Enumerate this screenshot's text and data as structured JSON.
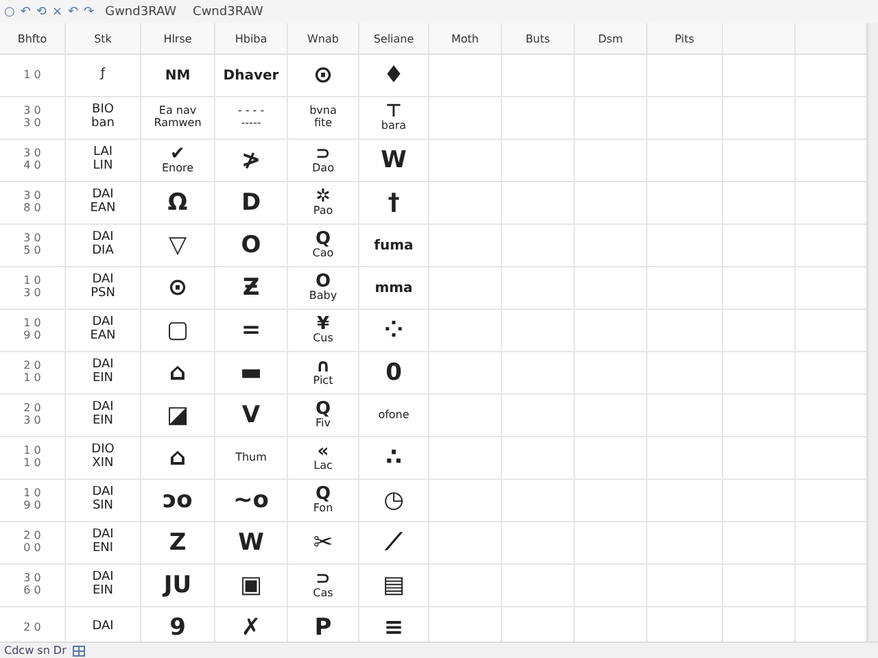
{
  "toolbar": {
    "icons": [
      "○",
      "↶",
      "⟲",
      "×",
      "↶",
      "↷"
    ],
    "tabs": [
      "Gwnd3RAW",
      "Cwnd3RAW"
    ]
  },
  "table": {
    "columns": [
      "Bhfto",
      "Stk",
      "Hlrse",
      "Hbiba",
      "Wnab",
      "Seliane",
      "Moth",
      "Buts",
      "Dsm",
      "Pits",
      "",
      ""
    ],
    "rows": [
      {
        "cells": [
          {
            "kind": "num",
            "lines": [
              "1 0"
            ]
          },
          {
            "kind": "code",
            "lines": [
              "ƒ"
            ]
          },
          {
            "kind": "word",
            "text": "NM"
          },
          {
            "kind": "word",
            "text": "Dhaver"
          },
          {
            "kind": "symbol",
            "text": "⊙"
          },
          {
            "kind": "symbol",
            "text": "♦"
          }
        ]
      },
      {
        "cells": [
          {
            "kind": "num",
            "lines": [
              "3 0",
              "3 0"
            ]
          },
          {
            "kind": "code",
            "lines": [
              "BIO",
              "ban"
            ]
          },
          {
            "kind": "note",
            "lines": [
              "Ea nav",
              "Ramwen"
            ]
          },
          {
            "kind": "note",
            "lines": [
              "- - - -",
              "-----"
            ]
          },
          {
            "kind": "note",
            "lines": [
              "bvna",
              "fite"
            ]
          },
          {
            "kind": "symbol",
            "text": "⊤",
            "caption": "bara"
          }
        ]
      },
      {
        "cells": [
          {
            "kind": "num",
            "lines": [
              "3 0",
              "4 0"
            ]
          },
          {
            "kind": "code",
            "lines": [
              "LAI",
              "LIN"
            ]
          },
          {
            "kind": "symbol",
            "text": "✔",
            "caption": "Enore"
          },
          {
            "kind": "symbol",
            "text": "≯"
          },
          {
            "kind": "symbol",
            "text": "⊃",
            "caption": "Dao"
          },
          {
            "kind": "symbol",
            "text": "W"
          }
        ]
      },
      {
        "cells": [
          {
            "kind": "num",
            "lines": [
              "3 0",
              "8 0"
            ]
          },
          {
            "kind": "code",
            "lines": [
              "DAI",
              "EAN"
            ]
          },
          {
            "kind": "symbol",
            "text": "Ω"
          },
          {
            "kind": "symbol",
            "text": "D"
          },
          {
            "kind": "symbol",
            "text": "✲",
            "caption": "Pao"
          },
          {
            "kind": "symbol",
            "text": "†"
          }
        ]
      },
      {
        "cells": [
          {
            "kind": "num",
            "lines": [
              "3 0",
              "5 0"
            ]
          },
          {
            "kind": "code",
            "lines": [
              "DAI",
              "DIA"
            ]
          },
          {
            "kind": "symbol",
            "text": "▽"
          },
          {
            "kind": "symbol",
            "text": "O"
          },
          {
            "kind": "symbol",
            "text": "Q",
            "caption": "Cao"
          },
          {
            "kind": "word",
            "text": "fuma"
          }
        ]
      },
      {
        "cells": [
          {
            "kind": "num",
            "lines": [
              "1 0",
              "3 0"
            ]
          },
          {
            "kind": "code",
            "lines": [
              "DAI",
              "PSN"
            ]
          },
          {
            "kind": "symbol",
            "text": "⊙"
          },
          {
            "kind": "symbol",
            "text": "Ƶ"
          },
          {
            "kind": "symbol",
            "text": "O",
            "caption": "Baby"
          },
          {
            "kind": "word",
            "text": "mma"
          }
        ]
      },
      {
        "cells": [
          {
            "kind": "num",
            "lines": [
              "1 0",
              "9 0"
            ]
          },
          {
            "kind": "code",
            "lines": [
              "DAI",
              "EAN"
            ]
          },
          {
            "kind": "symbol",
            "text": "▢"
          },
          {
            "kind": "symbol",
            "text": "="
          },
          {
            "kind": "symbol",
            "text": "¥",
            "caption": "Cus"
          },
          {
            "kind": "symbol",
            "text": "⁘"
          }
        ]
      },
      {
        "cells": [
          {
            "kind": "num",
            "lines": [
              "2 0",
              "1 0"
            ]
          },
          {
            "kind": "code",
            "lines": [
              "DAI",
              "EIN"
            ]
          },
          {
            "kind": "symbol",
            "text": "⌂"
          },
          {
            "kind": "symbol",
            "text": "▬"
          },
          {
            "kind": "symbol",
            "text": "∩",
            "caption": "Pict"
          },
          {
            "kind": "symbol",
            "text": "0"
          }
        ]
      },
      {
        "cells": [
          {
            "kind": "num",
            "lines": [
              "2 0",
              "3 0"
            ]
          },
          {
            "kind": "code",
            "lines": [
              "DAI",
              "EIN"
            ]
          },
          {
            "kind": "symbol",
            "text": "◪"
          },
          {
            "kind": "symbol",
            "text": "V"
          },
          {
            "kind": "symbol",
            "text": "Q",
            "caption": "Fiv"
          },
          {
            "kind": "note",
            "lines": [
              "ofone"
            ]
          }
        ]
      },
      {
        "cells": [
          {
            "kind": "num",
            "lines": [
              "1 0",
              "1 0"
            ]
          },
          {
            "kind": "code",
            "lines": [
              "DIO",
              "XIN"
            ]
          },
          {
            "kind": "symbol",
            "text": "⌂"
          },
          {
            "kind": "note",
            "lines": [
              "Thum"
            ]
          },
          {
            "kind": "symbol",
            "text": "«",
            "caption": "Lac"
          },
          {
            "kind": "symbol",
            "text": "∴"
          }
        ]
      },
      {
        "cells": [
          {
            "kind": "num",
            "lines": [
              "1 0",
              "9 0"
            ]
          },
          {
            "kind": "code",
            "lines": [
              "DAI",
              "SIN"
            ]
          },
          {
            "kind": "symbol",
            "text": "ɔo"
          },
          {
            "kind": "symbol",
            "text": "~o"
          },
          {
            "kind": "symbol",
            "text": "Q",
            "caption": "Fon"
          },
          {
            "kind": "symbol",
            "text": "◷"
          }
        ]
      },
      {
        "cells": [
          {
            "kind": "num",
            "lines": [
              "2 0",
              "0 0"
            ]
          },
          {
            "kind": "code",
            "lines": [
              "DAI",
              "ENI"
            ]
          },
          {
            "kind": "symbol",
            "text": "Z"
          },
          {
            "kind": "symbol",
            "text": "W"
          },
          {
            "kind": "symbol",
            "text": "✂"
          },
          {
            "kind": "symbol",
            "text": "⟋"
          }
        ]
      },
      {
        "cells": [
          {
            "kind": "num",
            "lines": [
              "3 0",
              "6 0"
            ]
          },
          {
            "kind": "code",
            "lines": [
              "DAI",
              "EIN"
            ]
          },
          {
            "kind": "symbol",
            "text": "JU"
          },
          {
            "kind": "symbol",
            "text": "▣"
          },
          {
            "kind": "symbol",
            "text": "⊃",
            "caption": "Cas"
          },
          {
            "kind": "symbol",
            "text": "▤"
          }
        ]
      },
      {
        "cells": [
          {
            "kind": "num",
            "lines": [
              "2 0"
            ]
          },
          {
            "kind": "code",
            "lines": [
              "DAI"
            ]
          },
          {
            "kind": "symbol",
            "text": "9"
          },
          {
            "kind": "symbol",
            "text": "✗"
          },
          {
            "kind": "symbol",
            "text": "P"
          },
          {
            "kind": "symbol",
            "text": "≡"
          }
        ]
      }
    ]
  },
  "status_bar": {
    "text": "Cdcw sn Dr"
  }
}
